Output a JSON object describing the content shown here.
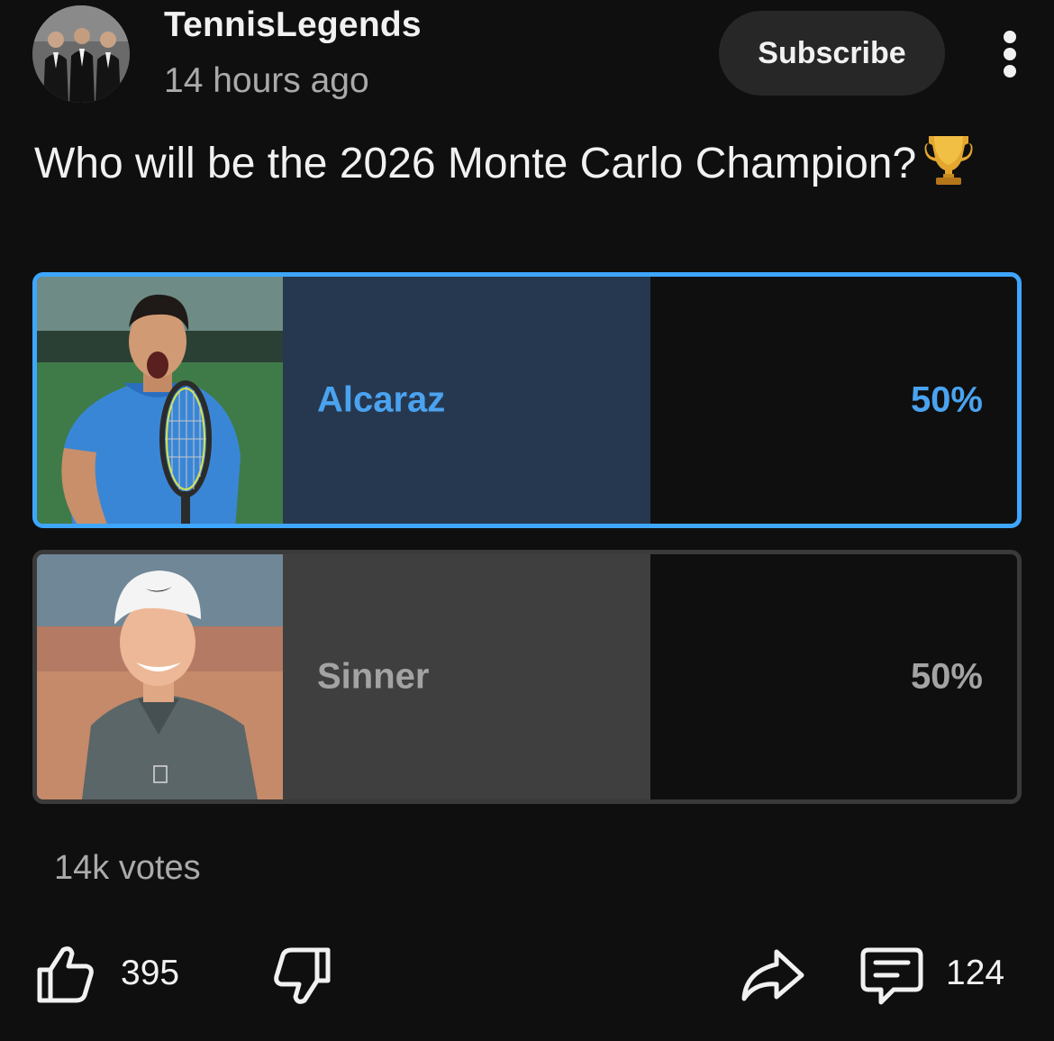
{
  "post": {
    "channel_name": "TennisLegends",
    "time_ago": "14 hours ago",
    "subscribe_label": "Subscribe",
    "question": "Who will be the 2026 Monte Carlo Champion?",
    "trophy_icon": "trophy-emoji"
  },
  "poll": {
    "options": [
      {
        "label": "Alcaraz",
        "percent_label": "50%",
        "share": 0.5,
        "selected": true,
        "photo": "player-photo-alcaraz"
      },
      {
        "label": "Sinner",
        "percent_label": "50%",
        "share": 0.5,
        "selected": false,
        "photo": "player-photo-sinner"
      }
    ],
    "votes": "14k votes"
  },
  "actions": {
    "like_count": "395",
    "comment_count": "124",
    "icons": [
      "like-icon",
      "dislike-icon",
      "share-icon",
      "comment-icon"
    ]
  },
  "colors": {
    "background": "#0f0f0f",
    "accent": "#3ea6ff",
    "selected_fill": "#263850",
    "unselected_fill": "#3f3f3f",
    "subscribe_bg": "#272727",
    "muted_text": "#aaaaaa"
  }
}
